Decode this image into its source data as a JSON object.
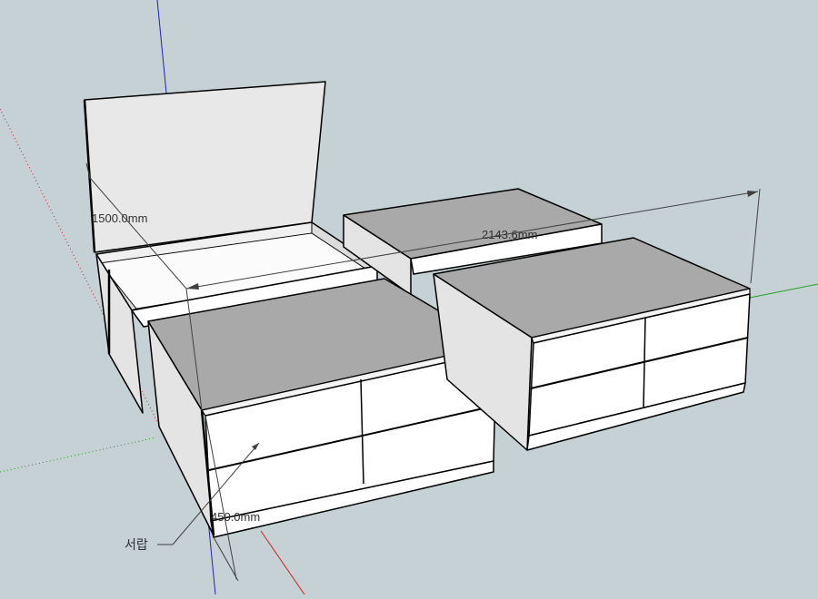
{
  "viewport": {
    "background": "#c5d1d4",
    "axis_colors": {
      "red": "#d02020",
      "green": "#20a020",
      "blue": "#2020c0"
    }
  },
  "dimensions": {
    "lid_height": "1500.0mm",
    "overall_length": "2143.6mm",
    "drawer_depth": "450.0mm"
  },
  "labels": {
    "drawer_note": "서랍"
  },
  "colors": {
    "top_face": "#a9a9a9",
    "front_face": "#ffffff",
    "side_face": "#e4e4e4",
    "lid_panel": "#e8e8e8",
    "edge": "#000000",
    "dimension_line": "#404040"
  }
}
